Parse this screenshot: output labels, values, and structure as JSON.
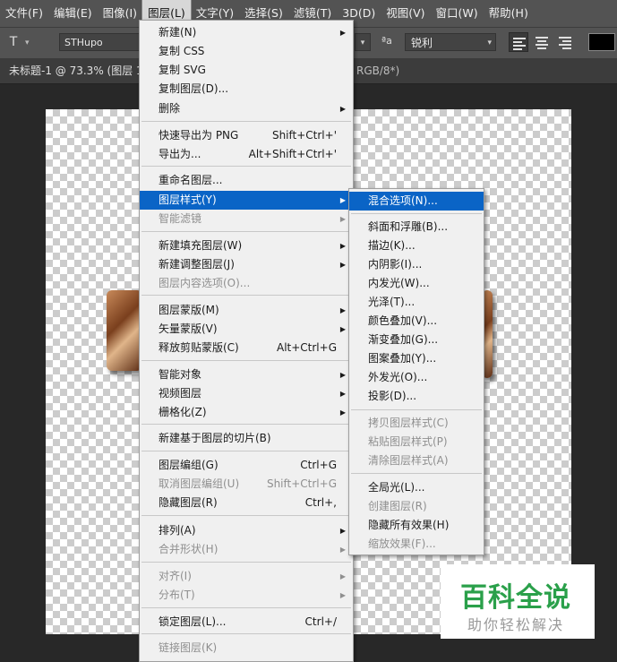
{
  "menubar": {
    "items": [
      "文件(F)",
      "编辑(E)",
      "图像(I)",
      "图层(L)",
      "文字(Y)",
      "选择(S)",
      "滤镜(T)",
      "3D(D)",
      "视图(V)",
      "窗口(W)",
      "帮助(H)"
    ],
    "active_index": 3
  },
  "options": {
    "font_family": "STHupo",
    "aa_value": "锐利",
    "aa_icon": "aa-icon",
    "color_swatch": "#000000"
  },
  "document": {
    "tab_title": "未标题-1 @ 73.3% (图层 1",
    "tab_title_right": "RGB/8*)"
  },
  "layer_menu": {
    "items": [
      {
        "label": "新建(N)",
        "shortcut": "",
        "submenu": true,
        "disabled": false
      },
      {
        "label": "复制 CSS",
        "shortcut": "",
        "submenu": false,
        "disabled": false
      },
      {
        "label": "复制 SVG",
        "shortcut": "",
        "submenu": false,
        "disabled": false
      },
      {
        "label": "复制图层(D)...",
        "shortcut": "",
        "submenu": false,
        "disabled": false
      },
      {
        "label": "删除",
        "shortcut": "",
        "submenu": true,
        "disabled": false
      },
      {
        "label": "快速导出为 PNG",
        "shortcut": "Shift+Ctrl+'",
        "submenu": false,
        "disabled": false
      },
      {
        "label": "导出为...",
        "shortcut": "Alt+Shift+Ctrl+'",
        "submenu": false,
        "disabled": false
      },
      {
        "label": "重命名图层...",
        "shortcut": "",
        "submenu": false,
        "disabled": false
      },
      {
        "label": "图层样式(Y)",
        "shortcut": "",
        "submenu": true,
        "disabled": false,
        "highlighted": true
      },
      {
        "label": "智能滤镜",
        "shortcut": "",
        "submenu": true,
        "disabled": true
      },
      {
        "label": "新建填充图层(W)",
        "shortcut": "",
        "submenu": true,
        "disabled": false
      },
      {
        "label": "新建调整图层(J)",
        "shortcut": "",
        "submenu": true,
        "disabled": false
      },
      {
        "label": "图层内容选项(O)...",
        "shortcut": "",
        "submenu": false,
        "disabled": true
      },
      {
        "label": "图层蒙版(M)",
        "shortcut": "",
        "submenu": true,
        "disabled": false
      },
      {
        "label": "矢量蒙版(V)",
        "shortcut": "",
        "submenu": true,
        "disabled": false
      },
      {
        "label": "释放剪贴蒙版(C)",
        "shortcut": "Alt+Ctrl+G",
        "submenu": false,
        "disabled": false
      },
      {
        "label": "智能对象",
        "shortcut": "",
        "submenu": true,
        "disabled": false
      },
      {
        "label": "视频图层",
        "shortcut": "",
        "submenu": true,
        "disabled": false
      },
      {
        "label": "栅格化(Z)",
        "shortcut": "",
        "submenu": true,
        "disabled": false
      },
      {
        "label": "新建基于图层的切片(B)",
        "shortcut": "",
        "submenu": false,
        "disabled": false
      },
      {
        "label": "图层编组(G)",
        "shortcut": "Ctrl+G",
        "submenu": false,
        "disabled": false
      },
      {
        "label": "取消图层编组(U)",
        "shortcut": "Shift+Ctrl+G",
        "submenu": false,
        "disabled": true
      },
      {
        "label": "隐藏图层(R)",
        "shortcut": "Ctrl+,",
        "submenu": false,
        "disabled": false
      },
      {
        "label": "排列(A)",
        "shortcut": "",
        "submenu": true,
        "disabled": false
      },
      {
        "label": "合并形状(H)",
        "shortcut": "",
        "submenu": true,
        "disabled": true
      },
      {
        "label": "对齐(I)",
        "shortcut": "",
        "submenu": true,
        "disabled": true
      },
      {
        "label": "分布(T)",
        "shortcut": "",
        "submenu": true,
        "disabled": true
      },
      {
        "label": "锁定图层(L)...",
        "shortcut": "Ctrl+/",
        "submenu": false,
        "disabled": false
      },
      {
        "label": "链接图层(K)",
        "shortcut": "",
        "submenu": false,
        "disabled": true
      }
    ]
  },
  "style_submenu": {
    "items": [
      {
        "label": "混合选项(N)...",
        "disabled": false,
        "highlighted": true
      },
      {
        "label": "斜面和浮雕(B)...",
        "disabled": false
      },
      {
        "label": "描边(K)...",
        "disabled": false
      },
      {
        "label": "内阴影(I)...",
        "disabled": false
      },
      {
        "label": "内发光(W)...",
        "disabled": false
      },
      {
        "label": "光泽(T)...",
        "disabled": false
      },
      {
        "label": "颜色叠加(V)...",
        "disabled": false
      },
      {
        "label": "渐变叠加(G)...",
        "disabled": false
      },
      {
        "label": "图案叠加(Y)...",
        "disabled": false
      },
      {
        "label": "外发光(O)...",
        "disabled": false
      },
      {
        "label": "投影(D)...",
        "disabled": false
      },
      {
        "label": "拷贝图层样式(C)",
        "disabled": true
      },
      {
        "label": "粘贴图层样式(P)",
        "disabled": true
      },
      {
        "label": "清除图层样式(A)",
        "disabled": true
      },
      {
        "label": "全局光(L)...",
        "disabled": false
      },
      {
        "label": "创建图层(R)",
        "disabled": true
      },
      {
        "label": "隐藏所有效果(H)",
        "disabled": false
      },
      {
        "label": "缩放效果(F)...",
        "disabled": true
      }
    ]
  },
  "watermark": {
    "title": "百科全说",
    "subtitle": "助你轻松解决"
  }
}
